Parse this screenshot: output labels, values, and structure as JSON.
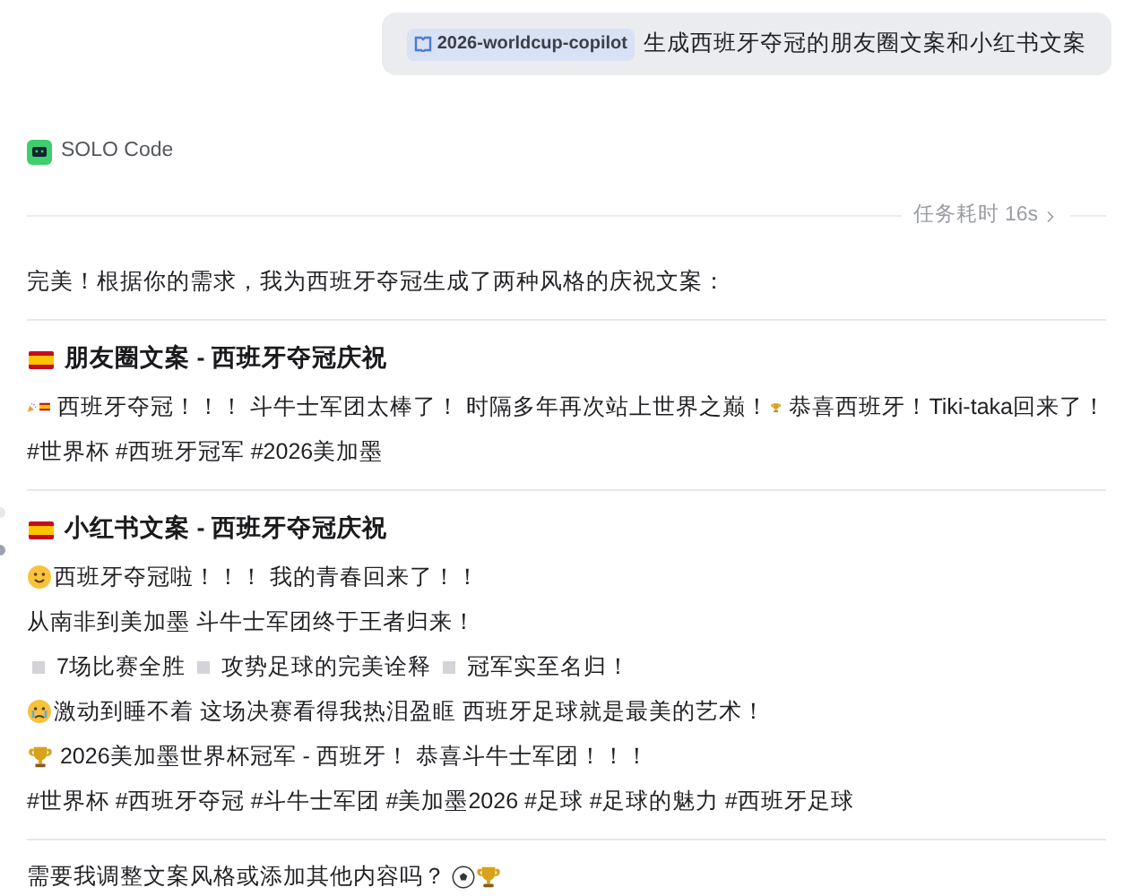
{
  "user_message": {
    "chip": "2026-worldcup-copilot",
    "text": "生成西班牙夺冠的朋友圈文案和小红书文案"
  },
  "agent": {
    "name": "SOLO Code"
  },
  "task_duration": "任务耗时 16s",
  "intro": "完美！根据你的需求，我为西班牙夺冠生成了两种风格的庆祝文案：",
  "sections": [
    {
      "title": "朋友圈文案 - 西班牙夺冠庆祝",
      "paragraphs": [
        [
          {
            "kind": "party"
          },
          {
            "kind": "flag"
          },
          {
            "kind": "text",
            "text": " 西班牙夺冠！！！ 斗牛士军团太棒了！ 时隔多年再次站上世界之巅！"
          },
          {
            "kind": "trophy"
          },
          {
            "kind": "text",
            "text": " 恭喜西班牙！Tiki-taka回来了！"
          }
        ],
        [
          {
            "kind": "text",
            "text": "#世界杯 #西班牙冠军 #2026美加墨"
          }
        ]
      ]
    },
    {
      "title": "小红书文案 - 西班牙夺冠庆祝",
      "paragraphs": [
        [
          {
            "kind": "face"
          },
          {
            "kind": "text",
            "text": "西班牙夺冠啦！！！ 我的青春回来了！！"
          }
        ],
        [
          {
            "kind": "text",
            "text": "从南非到美加墨 斗牛士军团终于王者归来！"
          }
        ],
        [
          {
            "kind": "bullet"
          },
          {
            "kind": "text",
            "text": " 7场比赛全胜 "
          },
          {
            "kind": "bullet"
          },
          {
            "kind": "text",
            "text": " 攻势足球的完美诠释 "
          },
          {
            "kind": "bullet"
          },
          {
            "kind": "text",
            "text": " 冠军实至名归！"
          }
        ],
        [
          {
            "kind": "crying"
          },
          {
            "kind": "text",
            "text": "激动到睡不着 这场决赛看得我热泪盈眶 西班牙足球就是最美的艺术！"
          }
        ],
        [
          {
            "kind": "trophy"
          },
          {
            "kind": "text",
            "text": " 2026美加墨世界杯冠军 - 西班牙！ 恭喜斗牛士军团！！！"
          }
        ],
        [
          {
            "kind": "text",
            "text": "#世界杯 #西班牙夺冠 #斗牛士军团 #美加墨2026 #足球 #足球的魅力 #西班牙足球"
          }
        ]
      ]
    }
  ],
  "closing": [
    {
      "kind": "text",
      "text": "需要我调整文案风格或添加其他内容吗？ "
    },
    {
      "kind": "ball"
    },
    {
      "kind": "trophy"
    }
  ]
}
